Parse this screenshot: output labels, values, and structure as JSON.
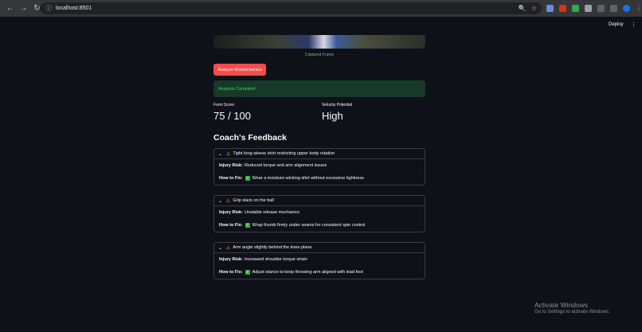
{
  "browser": {
    "url": "localhost:8501"
  },
  "header": {
    "deploy_label": "Deploy"
  },
  "frame": {
    "caption": "Captured Frame"
  },
  "analyze_button": "Analyze Biomechanics",
  "status": "Analysis Complete!",
  "metrics": [
    {
      "label": "Form Score",
      "value": "75 / 100"
    },
    {
      "label": "Velocity Potential",
      "value": "High"
    }
  ],
  "feedback_title": "Coach's Feedback",
  "feedback": [
    {
      "title": "Tight long-sleeve shirt restricting upper body rotation",
      "risk_label": "Injury Risk:",
      "risk": "Reduced torque and arm alignment issues",
      "fix_label": "How to Fix:",
      "fix": "Wear a moisture-wicking shirt without excessive tightness"
    },
    {
      "title": "Grip slack on the ball",
      "risk_label": "Injury Risk:",
      "risk": "Unstable release mechanics",
      "fix_label": "How to Fix:",
      "fix": "Wrap thumb firmly under seams for consistent spin control"
    },
    {
      "title": "Arm angle slightly behind the knee plane",
      "risk_label": "Injury Risk:",
      "risk": "Increased shoulder torque strain",
      "fix_label": "How to Fix:",
      "fix": "Adjust stance to keep throwing arm aligned with lead foot"
    }
  ],
  "watermark": {
    "line1": "Activate Windows",
    "line2": "Go to Settings to activate Windows."
  },
  "colors": {
    "accent": "#ff4b4b",
    "success_bg": "#173928",
    "success_text": "#3dd56d",
    "warning": "#ffbd45"
  }
}
